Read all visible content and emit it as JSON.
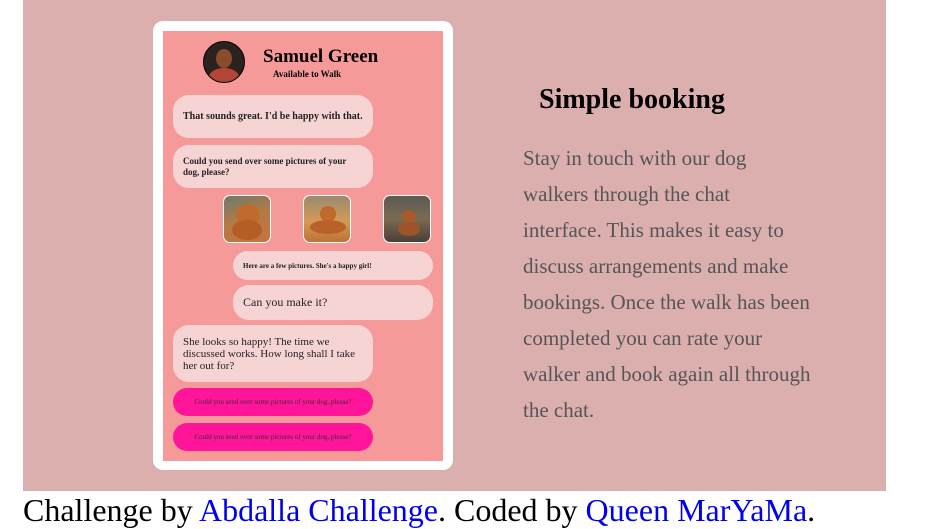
{
  "chat": {
    "profile": {
      "name": "Samuel Green",
      "status": "Available to Walk"
    },
    "messages": [
      {
        "text": "That sounds great. I'd be happy with that."
      },
      {
        "text": "Could you send over some pictures of your dog, please?"
      },
      {
        "text": "Here are a few pictures. She's a happy girl!"
      },
      {
        "text": "Can you make it?"
      },
      {
        "text": "She looks so happy! The time we discussed works. How long shall I take her out for?"
      },
      {
        "text": "Could you send over some pictures of your dog, please?"
      },
      {
        "text": "Could you send over some pictures of your dog, please?"
      }
    ],
    "photos": [
      "dog-photo",
      "dog-photo",
      "dog-photo"
    ]
  },
  "feature": {
    "title": "Simple booking",
    "description": "Stay in touch with our dog walkers through the chat interface. This makes it easy to discuss arrangements and make bookings. Once the walk has been completed you can rate your walker and book again all through the chat."
  },
  "footer": {
    "prefix": "Challenge by ",
    "challenge_link": "Abdalla Challenge",
    "middle": ". Coded by ",
    "author_link": "Queen MarYaMa",
    "suffix": "."
  },
  "colors": {
    "background": "#dcafaf",
    "screen": "#f69999",
    "bubble": "#f7d4d4",
    "accent": "#ff149a"
  }
}
